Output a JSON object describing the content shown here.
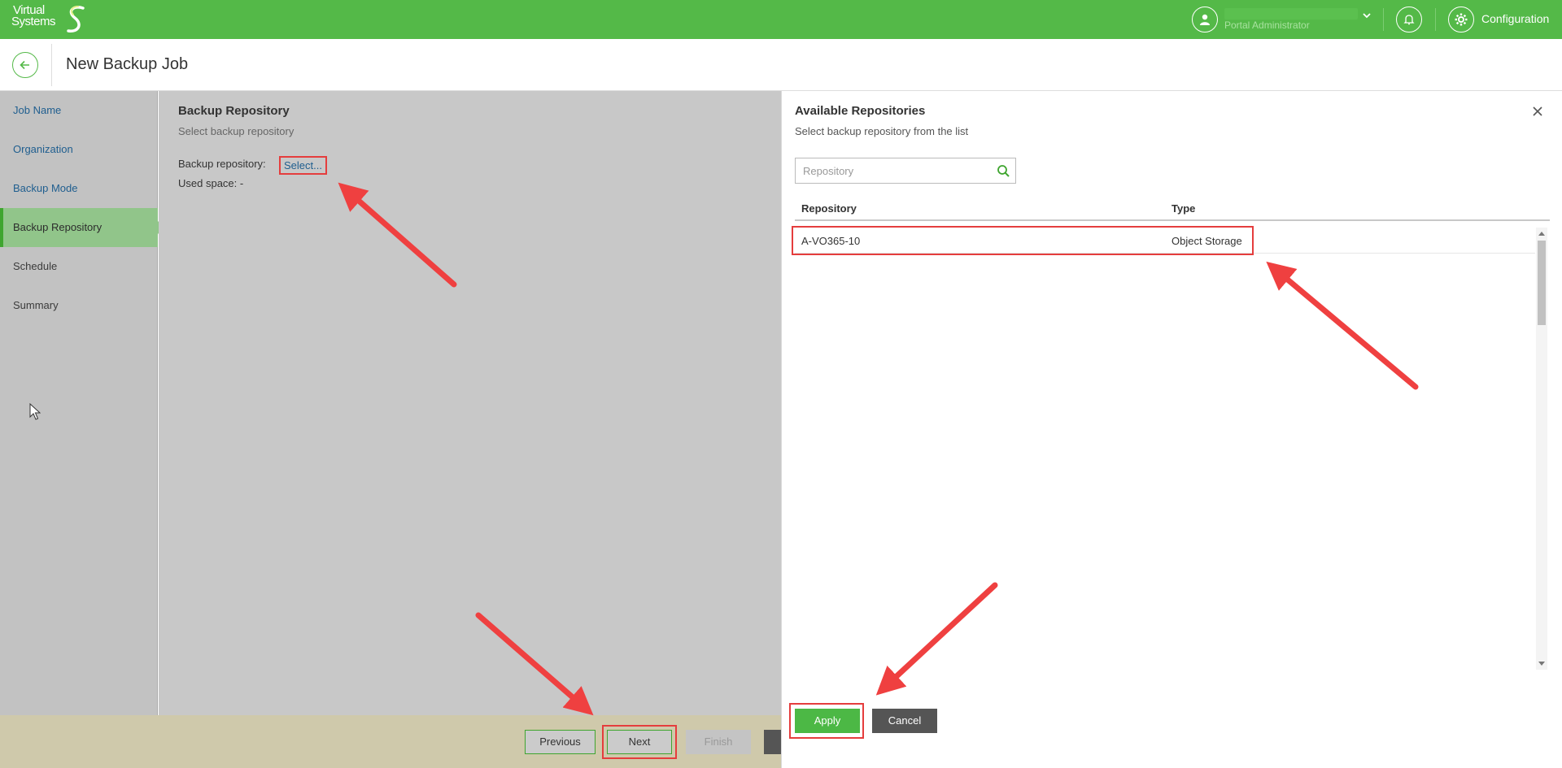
{
  "topbar": {
    "logo_line1": "Virtual",
    "logo_line2": "Systems",
    "user_role": "Portal Administrator",
    "config_label": "Configuration",
    "icons": [
      "user-icon",
      "chevron-down-icon",
      "bell-icon",
      "gear-icon"
    ]
  },
  "header": {
    "title": "New Backup Job"
  },
  "nav": {
    "items": [
      {
        "label": "Job Name",
        "state": "link"
      },
      {
        "label": "Organization",
        "state": "link"
      },
      {
        "label": "Backup Mode",
        "state": "link"
      },
      {
        "label": "Backup Repository",
        "state": "active"
      },
      {
        "label": "Schedule",
        "state": "disabled"
      },
      {
        "label": "Summary",
        "state": "disabled"
      }
    ]
  },
  "main": {
    "title": "Backup Repository",
    "subtitle": "Select backup repository",
    "repo_label": "Backup repository:",
    "repo_value": "Select...",
    "used_space": "Used space: -"
  },
  "footer": {
    "previous": "Previous",
    "next": "Next",
    "finish": "Finish"
  },
  "panel": {
    "title": "Available Repositories",
    "subtitle": "Select backup repository from the list",
    "search_placeholder": "Repository",
    "columns": {
      "repository": "Repository",
      "type": "Type"
    },
    "rows": [
      {
        "repository": "A-VO365-10",
        "type": "Object Storage"
      }
    ],
    "apply": "Apply",
    "cancel": "Cancel"
  },
  "colors": {
    "brand_green": "#54b948",
    "annotation_red": "#e53d3d",
    "link_blue": "#1f5e8f"
  }
}
